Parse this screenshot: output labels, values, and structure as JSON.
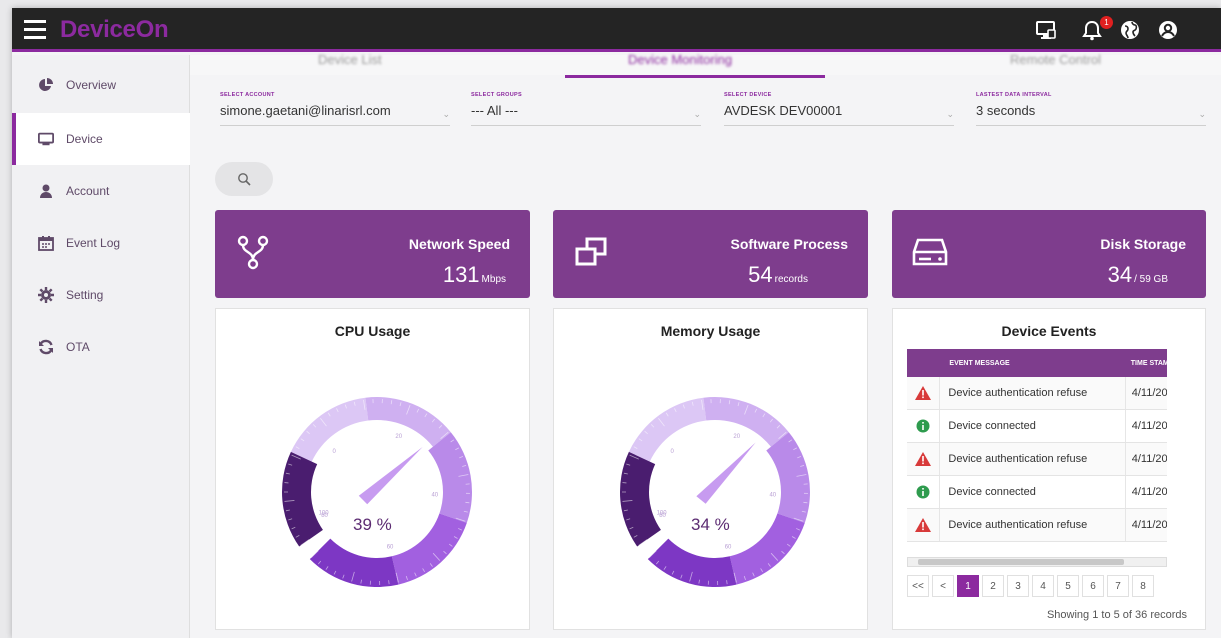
{
  "app": {
    "name": "DeviceOn",
    "notification_count": "1"
  },
  "topbar_icons": [
    "menu-icon",
    "monitor-icon",
    "bell-icon",
    "globe-icon",
    "user-icon"
  ],
  "sidebar": {
    "items": [
      {
        "label": "Overview",
        "icon": "pie-chart-icon"
      },
      {
        "label": "Device",
        "icon": "monitor-icon",
        "active": true
      },
      {
        "label": "Account",
        "icon": "person-icon"
      },
      {
        "label": "Event Log",
        "icon": "calendar-icon"
      },
      {
        "label": "Setting",
        "icon": "gear-icon"
      },
      {
        "label": "OTA",
        "icon": "refresh-icon"
      }
    ]
  },
  "tabs": {
    "items": [
      "Device List",
      "Device Monitoring",
      "Remote Control"
    ],
    "active": "Device Monitoring"
  },
  "filters": {
    "account": {
      "label": "SELECT ACCOUNT",
      "value": "simone.gaetani@linarisrl.com"
    },
    "groups": {
      "label": "SELECT GROUPS",
      "value": "--- All ---"
    },
    "device": {
      "label": "SELECT DEVICE",
      "value": "AVDESK DEV00001"
    },
    "interval": {
      "label": "LASTEST DATA INTERVAL",
      "value": "3 seconds"
    }
  },
  "stats": {
    "network": {
      "title": "Network Speed",
      "value": "131",
      "unit": "Mbps",
      "icon": "fork-icon"
    },
    "process": {
      "title": "Software Process",
      "value": "54",
      "unit": "records",
      "icon": "windows-stack-icon"
    },
    "disk": {
      "title": "Disk Storage",
      "value": "34",
      "unit": "/ 59 GB",
      "icon": "hard-drive-icon"
    }
  },
  "cpu": {
    "title": "CPU Usage",
    "value_text": "39 %",
    "percent": 39,
    "ticks": [
      "0",
      "20",
      "40",
      "60",
      "80",
      "100"
    ]
  },
  "memory": {
    "title": "Memory Usage",
    "value_text": "34 %",
    "percent": 34,
    "ticks": [
      "0",
      "20",
      "40",
      "60",
      "80",
      "100"
    ]
  },
  "events": {
    "title": "Device Events",
    "columns": [
      "EVENT MESSAGE",
      "TIME STAM"
    ],
    "rows": [
      {
        "type": "warning",
        "message": "Device authentication refuse",
        "time": "4/11/20:"
      },
      {
        "type": "info",
        "message": "Device connected",
        "time": "4/11/20:"
      },
      {
        "type": "warning",
        "message": "Device authentication refuse",
        "time": "4/11/20:"
      },
      {
        "type": "info",
        "message": "Device connected",
        "time": "4/11/20:"
      },
      {
        "type": "warning",
        "message": "Device authentication refuse",
        "time": "4/11/20:"
      }
    ],
    "pager": [
      "<<",
      "<",
      "1",
      "2",
      "3",
      "4",
      "5",
      "6",
      "7",
      "8"
    ],
    "current_page": "1",
    "footer": "Showing 1 to 5 of 36 records"
  },
  "colors": {
    "brand": "#8c2a9f",
    "card": "#7e3d8d",
    "warning": "#d83a3a",
    "info": "#2e9b4e"
  }
}
